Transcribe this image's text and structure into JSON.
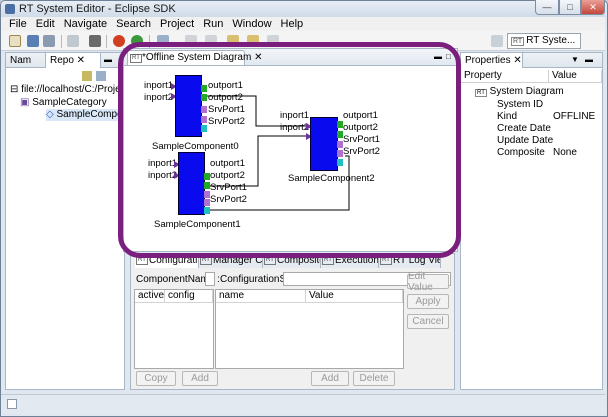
{
  "window": {
    "title": "RT System Editor - Eclipse SDK"
  },
  "menubar": {
    "items": [
      "File",
      "Edit",
      "Navigate",
      "Search",
      "Project",
      "Run",
      "Window",
      "Help"
    ]
  },
  "toolbar": {
    "perspective_label": "RT Syste...",
    "perspective_badge": "RT"
  },
  "left_panel": {
    "tabs": [
      "Nam",
      "Repo"
    ],
    "tree": [
      "file://localhost/C:/Projec",
      "SampleCategory",
      "SampleComponen"
    ]
  },
  "editor": {
    "tab_label": "*Offline System Diagram",
    "components": [
      {
        "name": "SampleComponent0",
        "inports": [
          "inport1",
          "inport2"
        ],
        "outports": [
          "outport1",
          "outport2"
        ],
        "services": [
          "SrvPort1",
          "SrvPort2"
        ]
      },
      {
        "name": "SampleComponent1",
        "inports": [
          "inport1",
          "inport2"
        ],
        "outports": [
          "outport1",
          "outport2"
        ],
        "services": [
          "SrvPort1",
          "SrvPort2"
        ]
      },
      {
        "name": "SampleComponent2",
        "inports": [
          "inport1",
          "inport2"
        ],
        "outports": [
          "outport1",
          "outport2"
        ],
        "services": [
          "SrvPort1",
          "SrvPort2"
        ]
      }
    ]
  },
  "bottom_panel": {
    "tabs": [
      "Configurati",
      "Manager Co",
      "Composite",
      "Execution",
      "RT Log Vie"
    ],
    "component_name_label": "ComponentName :",
    "configuration_set_label": "ConfigurationSet :",
    "left_table_headers": [
      "active",
      "config"
    ],
    "right_table_headers": [
      "name",
      "Value"
    ],
    "buttons": {
      "edit_value": "Edit Value",
      "apply": "Apply",
      "cancel": "Cancel",
      "copy": "Copy",
      "add_left": "Add",
      "add_right": "Add",
      "delete": "Delete"
    }
  },
  "properties": {
    "tab_label": "Properties",
    "headers": [
      "Property",
      "Value"
    ],
    "root": "System Diagram",
    "rows": [
      {
        "name": "System ID",
        "value": ""
      },
      {
        "name": "Kind",
        "value": "OFFLINE"
      },
      {
        "name": "Create Date",
        "value": ""
      },
      {
        "name": "Update Date",
        "value": ""
      },
      {
        "name": "Composite",
        "value": "None"
      }
    ]
  },
  "colors": {
    "component": "#0a0aee",
    "highlight": "#7a1f7e",
    "outport": "#22aa22",
    "inport": "#7030a0"
  }
}
